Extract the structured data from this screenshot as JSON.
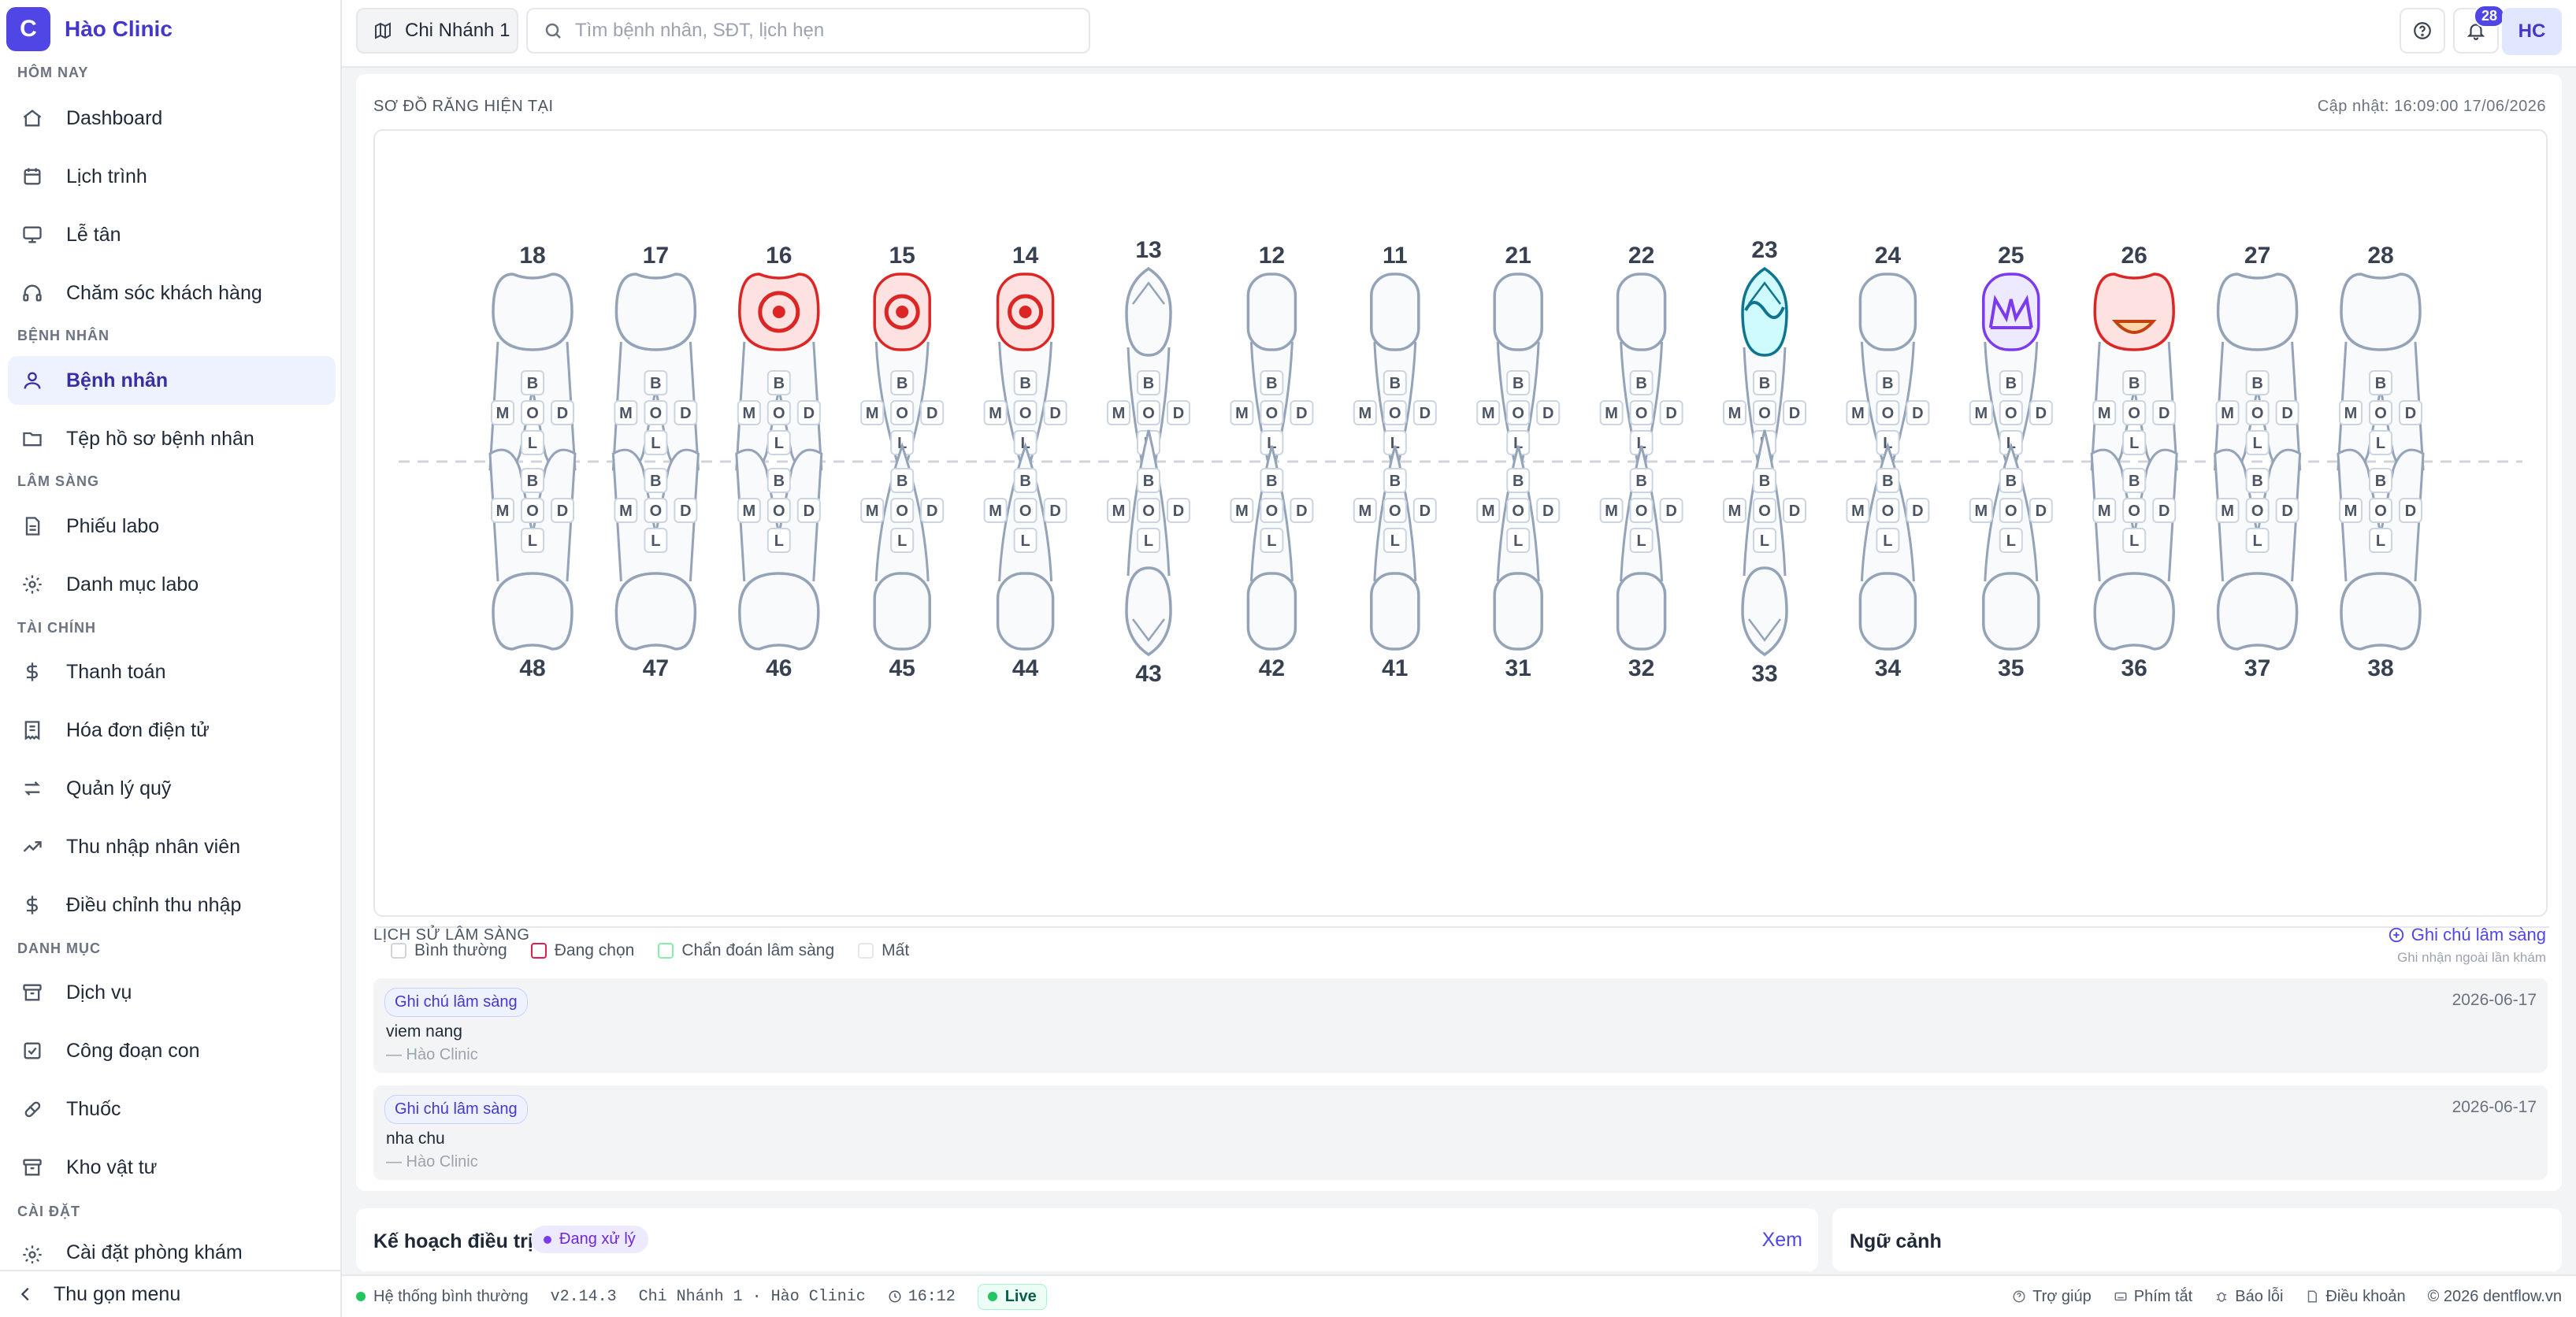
{
  "app": {
    "name": "Hào Clinic",
    "logo_letter": "C"
  },
  "sidebar": {
    "sections": [
      {
        "title": "HÔM NAY",
        "items": [
          {
            "label": "Dashboard",
            "icon": "home-icon"
          },
          {
            "label": "Lịch trình",
            "icon": "calendar-icon"
          },
          {
            "label": "Lễ tân",
            "icon": "monitor-icon"
          },
          {
            "label": "Chăm sóc khách hàng",
            "icon": "headset-icon"
          }
        ]
      },
      {
        "title": "BỆNH NHÂN",
        "items": [
          {
            "label": "Bệnh nhân",
            "icon": "user-icon",
            "active": true
          },
          {
            "label": "Tệp hồ sơ bệnh nhân",
            "icon": "folder-icon"
          }
        ]
      },
      {
        "title": "LÂM SÀNG",
        "items": [
          {
            "label": "Phiếu labo",
            "icon": "document-icon"
          },
          {
            "label": "Danh mục labo",
            "icon": "settings-icon"
          }
        ]
      },
      {
        "title": "TÀI CHÍNH",
        "items": [
          {
            "label": "Thanh toán",
            "icon": "dollar-icon"
          },
          {
            "label": "Hóa đơn điện tử",
            "icon": "receipt-icon"
          },
          {
            "label": "Quản lý quỹ",
            "icon": "transfer-icon"
          },
          {
            "label": "Thu nhập nhân viên",
            "icon": "trending-up-icon"
          },
          {
            "label": "Điều chỉnh thu nhập",
            "icon": "dollar-icon"
          }
        ]
      },
      {
        "title": "DANH MỤC",
        "items": [
          {
            "label": "Dịch vụ",
            "icon": "archive-icon"
          },
          {
            "label": "Công đoạn con",
            "icon": "checkbox-icon"
          },
          {
            "label": "Thuốc",
            "icon": "pill-icon"
          },
          {
            "label": "Kho vật tư",
            "icon": "archive-icon"
          }
        ]
      },
      {
        "title": "CÀI ĐẶT",
        "items": [
          {
            "label": "Cài đặt phòng khám",
            "icon": "settings-icon"
          }
        ]
      }
    ],
    "collapse_label": "Thu gọn menu"
  },
  "topbar": {
    "branch": "Chi Nhánh 1",
    "search_placeholder": "Tìm bệnh nhân, SĐT, lịch hẹn",
    "notification_count": "28",
    "avatar": "HC"
  },
  "chart": {
    "title": "SƠ ĐỒ RĂNG HIỆN TẠI",
    "updated": "Cập nhật: 16:09:00 17/06/2026",
    "upper_teeth": [
      "18",
      "17",
      "16",
      "15",
      "14",
      "13",
      "12",
      "11",
      "21",
      "22",
      "23",
      "24",
      "25",
      "26",
      "27",
      "28"
    ],
    "lower_teeth": [
      "48",
      "47",
      "46",
      "45",
      "44",
      "43",
      "42",
      "41",
      "31",
      "32",
      "33",
      "34",
      "35",
      "36",
      "37",
      "38"
    ],
    "surfaces": [
      "B",
      "M",
      "O",
      "D",
      "L"
    ],
    "marked": {
      "16": "red",
      "15": "red",
      "14": "red",
      "23": "teal",
      "25": "purple",
      "26": "red"
    },
    "legend": [
      {
        "label": "Bình thường",
        "color": "#d1d5db"
      },
      {
        "label": "Đang chọn",
        "color": "#e11d48"
      },
      {
        "label": "Chẩn đoán lâm sàng",
        "color": "#86efac"
      },
      {
        "label": "Mất",
        "color": "#e5e7eb"
      }
    ]
  },
  "history": {
    "title": "LỊCH SỬ LÂM SÀNG",
    "add_note": "Ghi chú lâm sàng",
    "add_note_sub": "Ghi nhận ngoài lần khám",
    "notes": [
      {
        "tag": "Ghi chú lâm sàng",
        "date": "2026-06-17",
        "text": "viem nang",
        "by": "— Hào Clinic"
      },
      {
        "tag": "Ghi chú lâm sàng",
        "date": "2026-06-17",
        "text": "nha chu",
        "by": "— Hào Clinic"
      }
    ]
  },
  "plan": {
    "title": "Kế hoạch điều trị",
    "status": "Đang xử lý",
    "view": "Xem"
  },
  "context": {
    "title": "Ngữ cảnh"
  },
  "statusbar": {
    "system": "Hệ thống bình thường",
    "version": "v2.14.3",
    "location": "Chi Nhánh 1 · Hào Clinic",
    "time": "16:12",
    "live": "Live",
    "links": [
      "Trợ giúp",
      "Phím tắt",
      "Báo lỗi",
      "Điều khoản"
    ],
    "copyright": "© 2026 dentflow.vn"
  },
  "colors": {
    "accent": "#4f46e5",
    "selected": "#e11d48",
    "tooth_outline": "#94a3b8"
  }
}
